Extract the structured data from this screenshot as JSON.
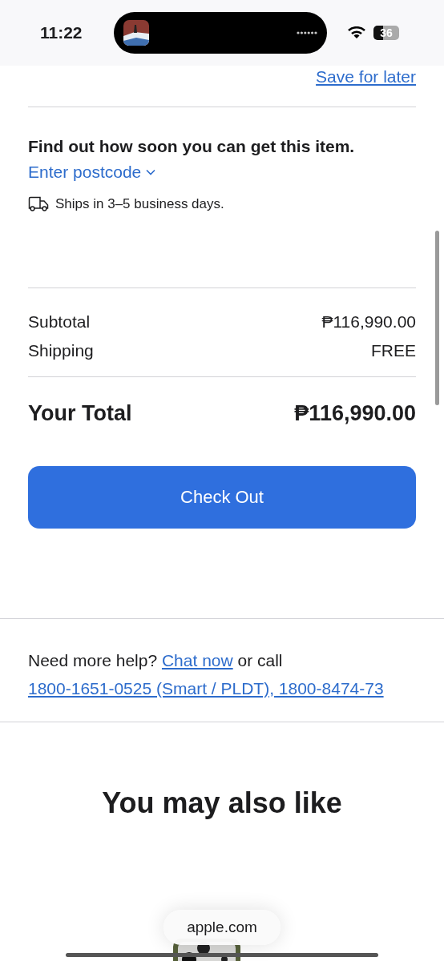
{
  "status_bar": {
    "time": "11:22",
    "battery": "36"
  },
  "save_link": "Save for later",
  "delivery": {
    "heading": "Find out how soon you can get this item.",
    "postcode_link": "Enter postcode",
    "shipping_note": "Ships in 3–5 business days."
  },
  "summary": [
    {
      "label": "Subtotal",
      "value": "₱116,990.00"
    },
    {
      "label": "Shipping",
      "value": "FREE"
    }
  ],
  "total": {
    "label": "Your Total",
    "value": "₱116,990.00"
  },
  "checkout_button": "Check Out",
  "help": {
    "text": "Need more help?",
    "chat_link": "Chat now",
    "text_after": "or call",
    "phone_link": "1800-1651-0525 (Smart / PLDT), 1800-8474-73"
  },
  "recommendations": {
    "heading": "You may also like"
  },
  "url_pill": "apple.com"
}
